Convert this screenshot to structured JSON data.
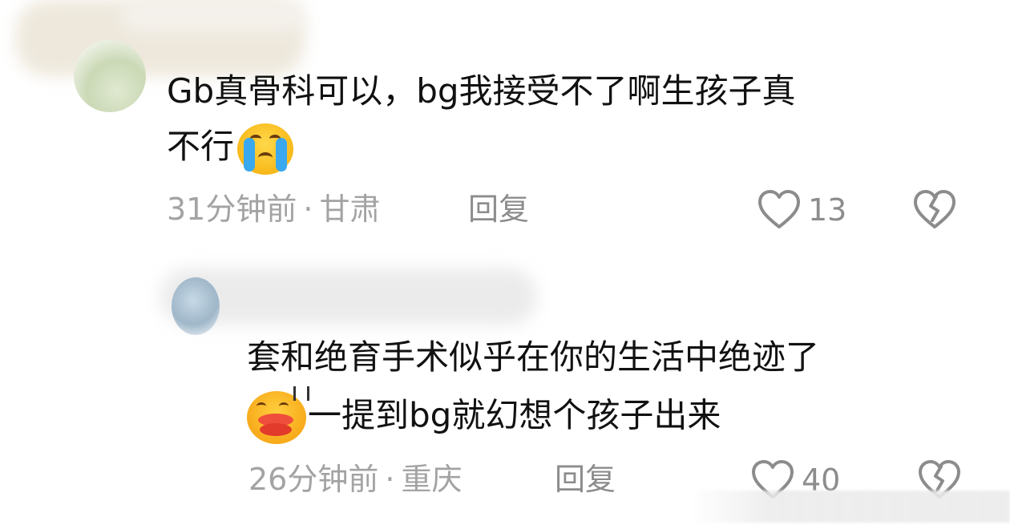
{
  "comments": [
    {
      "line1": "Gb真骨科可以，bg我接受不了啊生孩子真",
      "line2": "不行",
      "emoji": "loudly-crying-face",
      "time": "31分钟前",
      "separator": "·",
      "location": "甘肃",
      "reply_label": "回复",
      "like_count": "13"
    },
    {
      "line1": "套和绝育手术似乎在你的生活中绝迹了",
      "line2": "一提到bg就幻想个孩子出来",
      "emoji": "kissing-face-with-lips",
      "time": "26分钟前",
      "separator": "·",
      "location": "重庆",
      "reply_label": "回复",
      "like_count": "40"
    }
  ],
  "colors": {
    "text_primary": "#111111",
    "text_meta": "#a3a3a3",
    "icon_stroke": "#8c8c8c"
  }
}
